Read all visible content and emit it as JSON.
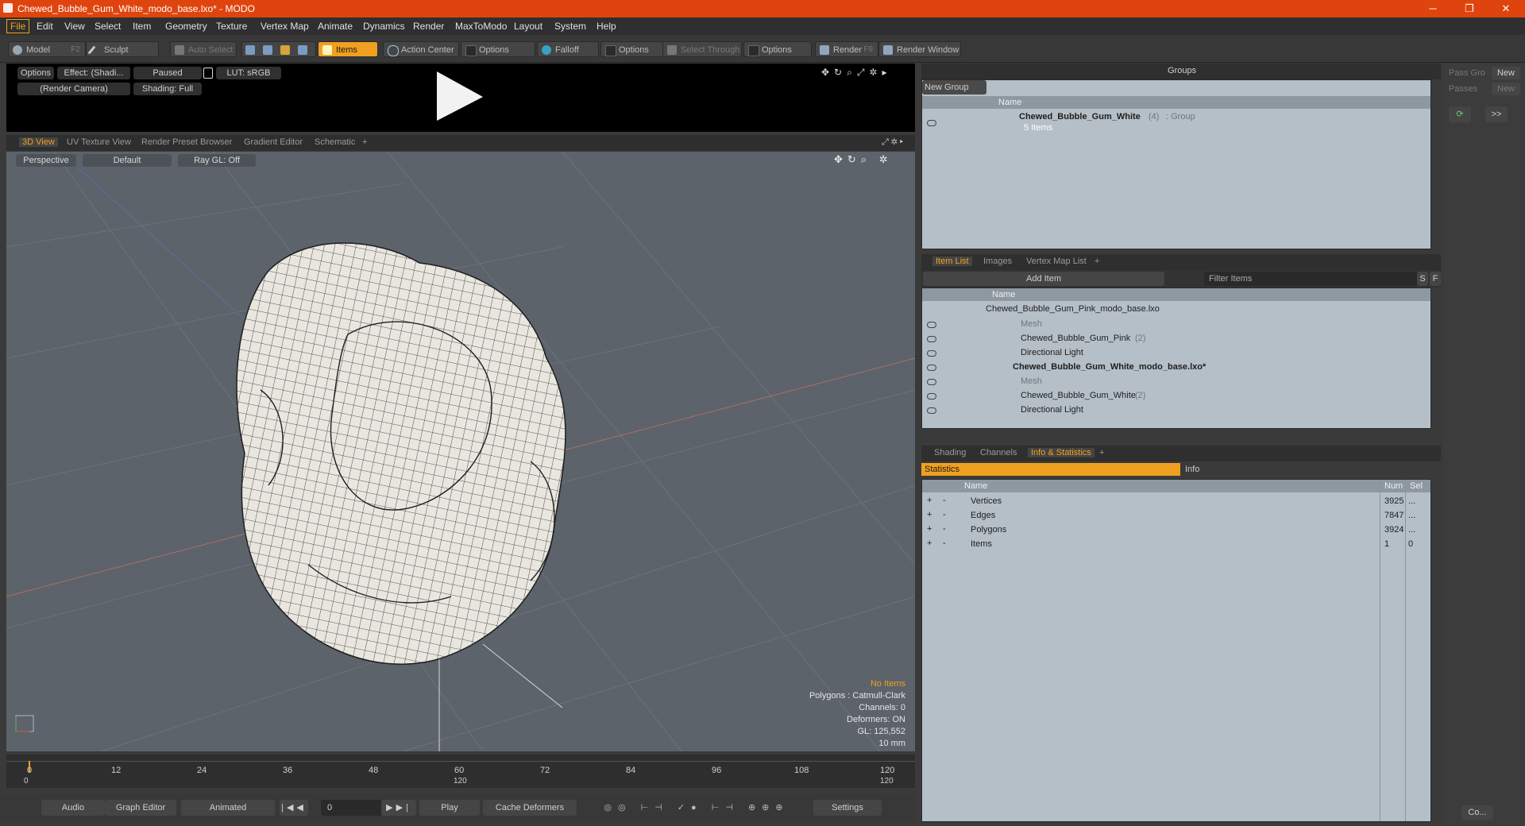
{
  "window": {
    "title": "Chewed_Bubble_Gum_White_modo_base.lxo* - MODO",
    "minimize": "─",
    "maximize": "❐",
    "close": "✕"
  },
  "menu": [
    "File",
    "Edit",
    "View",
    "Select",
    "Item",
    "Geometry",
    "Texture",
    "Vertex Map",
    "Animate",
    "Dynamics",
    "Render",
    "MaxToModo",
    "Layout",
    "System",
    "Help"
  ],
  "toolbar": {
    "model": "Model",
    "model_key": "F2",
    "sculpt": "Sculpt",
    "auto_select": "Auto Select",
    "items": "Items",
    "action_center": "Action Center",
    "options1": "Options",
    "falloff": "Falloff",
    "options2": "Options",
    "select_through": "Select Through",
    "options3": "Options",
    "render": "Render",
    "render_key": "F9",
    "render_window": "Render Window"
  },
  "preview": {
    "options": "Options",
    "effect": "Effect: (Shadi...",
    "paused": "Paused",
    "lut": "LUT: sRGB",
    "camera": "(Render Camera)",
    "shading": "Shading: Full"
  },
  "viewport_tabs": [
    "3D View",
    "UV Texture View",
    "Render Preset Browser",
    "Gradient Editor",
    "Schematic",
    "+"
  ],
  "viewport": {
    "perspective": "Perspective",
    "default": "Default",
    "raygl": "Ray GL: Off",
    "stats": {
      "no_items": "No Items",
      "polygons": "Polygons : Catmull-Clark",
      "channels": "Channels: 0",
      "deformers": "Deformers: ON",
      "gl": "GL: 125,552",
      "unit": "10 mm"
    }
  },
  "timeline": {
    "ticks": [
      "0",
      "12",
      "24",
      "36",
      "48",
      "60",
      "72",
      "84",
      "96",
      "108",
      "120"
    ],
    "low": [
      "0",
      "120",
      "120"
    ]
  },
  "bottom": {
    "audio": "Audio",
    "graph_editor": "Graph Editor",
    "animated": "Animated",
    "frame": "0",
    "play": "Play",
    "cache": "Cache Deformers",
    "settings": "Settings"
  },
  "groups": {
    "title": "Groups",
    "new_group": "New Group",
    "name_col": "Name",
    "item_name": "Chewed_Bubble_Gum_White",
    "item_count": "(4)",
    "item_type": ": Group",
    "item_sub": "5 Items"
  },
  "pass": {
    "pass_groups": "Pass Gro",
    "new1": "New",
    "passes": "Passes",
    "new2": "New",
    "arrows": ">>",
    "co": "Co..."
  },
  "itemlist": {
    "tabs": [
      "Item List",
      "Images",
      "Vertex Map List",
      "+"
    ],
    "add_item": "Add Item",
    "filter": "Filter Items",
    "s": "S",
    "f": "F",
    "name_col": "Name",
    "rows": [
      {
        "label": "Chewed_Bubble_Gum_Pink_modo_base.lxo",
        "extra": ""
      },
      {
        "label": "Mesh",
        "extra": ""
      },
      {
        "label": "Chewed_Bubble_Gum_Pink",
        "extra": "(2)"
      },
      {
        "label": "Directional Light",
        "extra": ""
      },
      {
        "label": "Chewed_Bubble_Gum_White_modo_base.lxo*",
        "extra": ""
      },
      {
        "label": "Mesh",
        "extra": ""
      },
      {
        "label": "Chewed_Bubble_Gum_White",
        "extra": "(2)"
      },
      {
        "label": "Directional Light",
        "extra": ""
      }
    ]
  },
  "info": {
    "tabs": [
      "Shading",
      "Channels",
      "Info & Statistics",
      "+"
    ],
    "statistics": "Statistics",
    "info": "Info",
    "cols": {
      "name": "Name",
      "num": "Num",
      "sel": "Sel"
    },
    "rows": [
      {
        "name": "Vertices",
        "num": "3925",
        "sel": "..."
      },
      {
        "name": "Edges",
        "num": "7847",
        "sel": "..."
      },
      {
        "name": "Polygons",
        "num": "3924",
        "sel": "..."
      },
      {
        "name": "Items",
        "num": "1",
        "sel": "0"
      }
    ]
  }
}
